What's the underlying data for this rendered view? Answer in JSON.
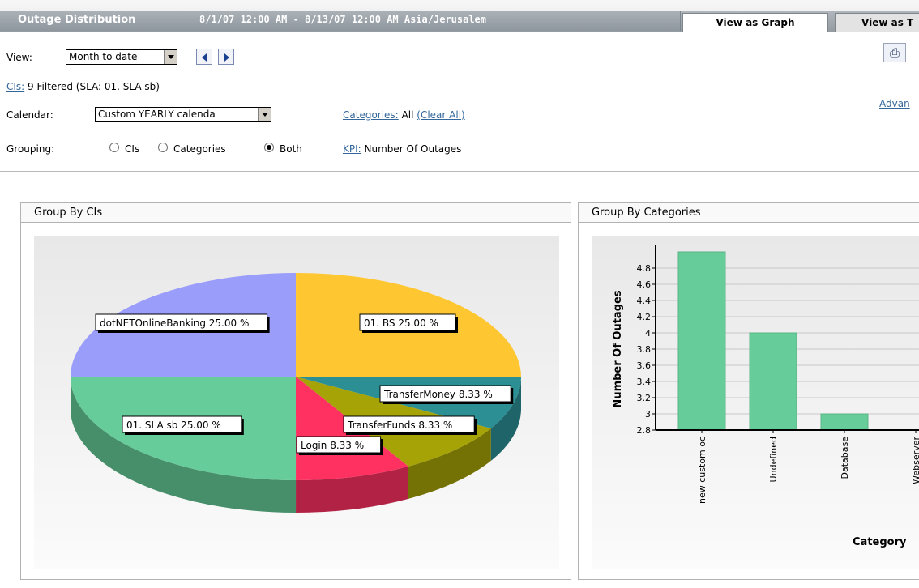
{
  "header": {
    "title": "Outage Distribution",
    "dates": "8/1/07 12:00 AM - 8/13/07 12:00 AM Asia/Jerusalem",
    "tabs": [
      "View as Graph",
      "View as T"
    ]
  },
  "controls": {
    "view_label": "View:",
    "view_value": "Month to date",
    "cis_link": "CIs:",
    "cis_text": "9 Filtered (SLA: 01. SLA sb)",
    "calendar_label": "Calendar:",
    "calendar_value": "Custom YEARLY calenda",
    "categories_link": "Categories:",
    "categories_value": "All",
    "clear_all": "(Clear All)",
    "grouping_label": "Grouping:",
    "grouping_options": [
      "CIs",
      "Categories",
      "Both"
    ],
    "grouping_selected": "Both",
    "kpi_link": "KPI:",
    "kpi_value": "Number Of Outages",
    "advanced_link": "Advan",
    "printer_icon": "printer-icon"
  },
  "panels": {
    "left_title": "Group By CIs",
    "right_title": "Group By Categories"
  },
  "chart_data": [
    {
      "type": "pie",
      "categories": [
        "dotNETOnlineBanking",
        "01. BS",
        "TransferMoney",
        "TransferFunds",
        "Login",
        "01. SLA sb"
      ],
      "values": [
        25.0,
        25.0,
        8.33,
        8.33,
        8.33,
        25.0
      ],
      "labels": [
        "dotNETOnlineBanking  25.00 %",
        "01. BS  25.00 %",
        "TransferMoney  8.33 %",
        "TransferFunds  8.33 %",
        "Login  8.33 %",
        "01. SLA sb  25.00 %"
      ],
      "colors": [
        "#9a9dfa",
        "#fec732",
        "#2b8f94",
        "#a6a306",
        "#fe3161",
        "#66cc99"
      ]
    },
    {
      "type": "bar",
      "categories": [
        "new custom oc",
        "Undefined",
        "Database",
        "Webserver"
      ],
      "values": [
        5.0,
        4.0,
        3.0,
        2.8
      ],
      "ylabel": "Number Of Outages",
      "xlabel": "Category",
      "ylim": [
        2.8,
        5.0
      ],
      "yticks": [
        "2.8",
        "3",
        "3.2",
        "3.4",
        "3.6",
        "3.8",
        "4",
        "4.2",
        "4.4",
        "4.6",
        "4.8"
      ],
      "color": "#66cc99"
    }
  ]
}
